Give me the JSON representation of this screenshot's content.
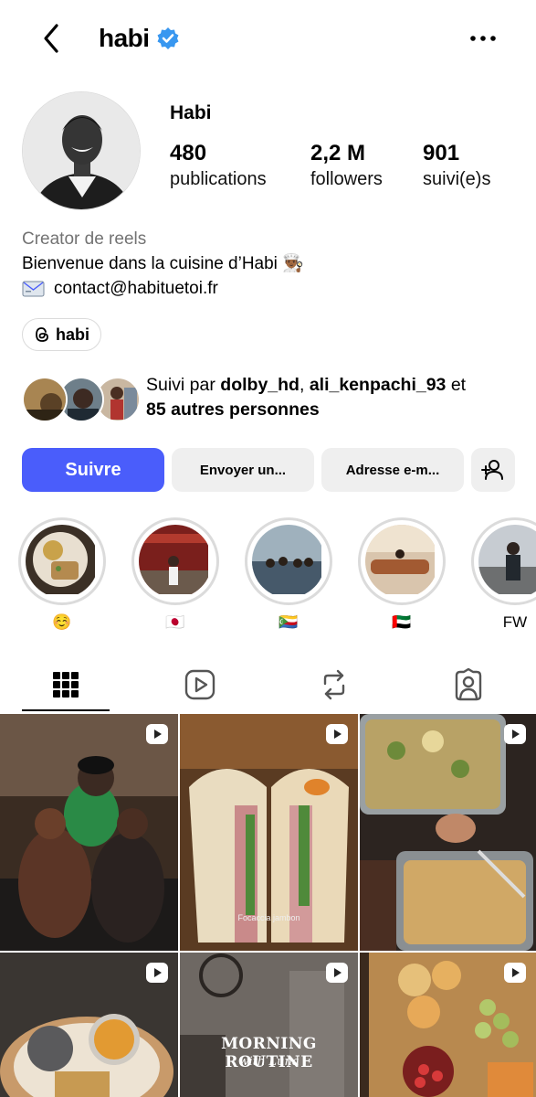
{
  "header": {
    "username": "habi",
    "back_icon": "chevron-left-icon",
    "verified_icon": "verified-badge-icon",
    "more_icon": "more-horizontal-icon"
  },
  "profile": {
    "display_name": "Habi",
    "stats": [
      {
        "value": "480",
        "label": "publications"
      },
      {
        "value": "2,2 M",
        "label": "followers"
      },
      {
        "value": "901",
        "label": "suivi(e)s"
      }
    ],
    "category": "Creator de reels",
    "bio_line": "Bienvenue dans la cuisine d’Habi 👨🏾‍🍳",
    "email": "contact@habituetoi.fr",
    "threads_label": "habi"
  },
  "followed_by": {
    "prefix": "Suivi par ",
    "user1": "dolby_hd",
    "sep": ", ",
    "user2": "ali_kenpachi_93",
    "and": " et",
    "others": "85 autres personnes"
  },
  "actions": {
    "follow": "Suivre",
    "message": "Envoyer un...",
    "email": "Adresse e-m...",
    "add_icon": "add-person-icon"
  },
  "highlights": [
    {
      "label": "☺️"
    },
    {
      "label": "🇯🇵"
    },
    {
      "label": "🇰🇲"
    },
    {
      "label": "🇦🇪"
    },
    {
      "label": "FW"
    }
  ],
  "tabs": [
    {
      "icon": "grid-icon",
      "active": true
    },
    {
      "icon": "reels-icon",
      "active": false
    },
    {
      "icon": "reposts-icon",
      "active": false
    },
    {
      "icon": "tagged-icon",
      "active": false
    }
  ],
  "grid": {
    "post5_title": "MORNING ROUTINE",
    "post5_subtitle": "with Luna",
    "post2_caption": "Focaccia jambon"
  },
  "colors": {
    "primary": "#4a5dfb",
    "verified": "#3897f0",
    "muted": "#737373"
  }
}
